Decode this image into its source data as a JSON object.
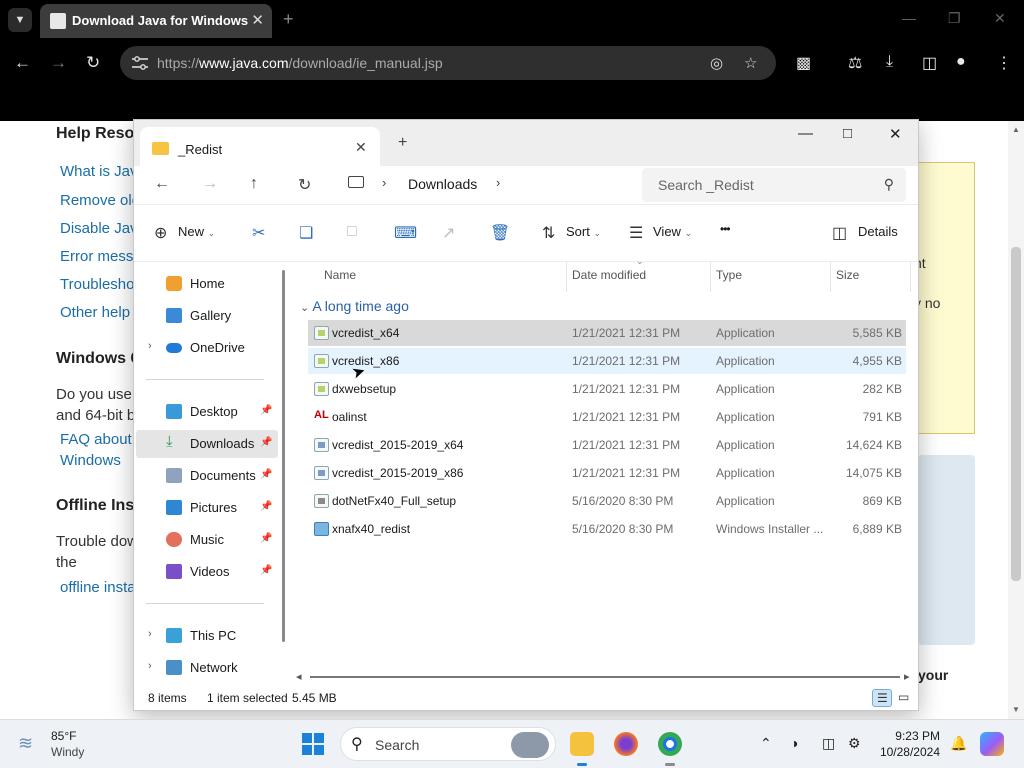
{
  "browser": {
    "tab_title": "Download Java for Windows",
    "url_prefix": "https://",
    "url_domain": "www.java.com",
    "url_path": "/download/ie_manual.jsp"
  },
  "page": {
    "heading1": "Help Reso",
    "links1": [
      "What is Jav",
      "Remove old",
      "Disable Jav",
      "Error mess",
      "Troublesho",
      "Other help"
    ],
    "heading2": "Windows 6",
    "text2a": "Do you use",
    "text2b": "and 64-bit b",
    "link2a": "FAQ about",
    "link2b": "Windows",
    "heading3": "Offline Ins",
    "text3a": "Trouble dow",
    "text3b": "the",
    "link3": "offline insta",
    "yellow_text1": "nt",
    "yellow_text2": "y no",
    "right_text": "your"
  },
  "explorer": {
    "tab_title": "_Redist",
    "breadcrumb": "Downloads",
    "search_placeholder": "Search _Redist",
    "commands": {
      "new": "New",
      "sort": "Sort",
      "view": "View",
      "more": "•••",
      "details": "Details"
    },
    "sidebar": {
      "home": "Home",
      "gallery": "Gallery",
      "onedrive": "OneDrive",
      "desktop": "Desktop",
      "downloads": "Downloads",
      "documents": "Documents",
      "pictures": "Pictures",
      "music": "Music",
      "videos": "Videos",
      "thispc": "This PC",
      "network": "Network"
    },
    "columns": {
      "name": "Name",
      "date": "Date modified",
      "type": "Type",
      "size": "Size"
    },
    "group_header": "A long time ago",
    "files": [
      {
        "name": "vcredist_x64",
        "date": "1/21/2021 12:31 PM",
        "type": "Application",
        "size": "5,585 KB"
      },
      {
        "name": "vcredist_x86",
        "date": "1/21/2021 12:31 PM",
        "type": "Application",
        "size": "4,955 KB"
      },
      {
        "name": "dxwebsetup",
        "date": "1/21/2021 12:31 PM",
        "type": "Application",
        "size": "282 KB"
      },
      {
        "name": "oalinst",
        "date": "1/21/2021 12:31 PM",
        "type": "Application",
        "size": "791 KB"
      },
      {
        "name": "vcredist_2015-2019_x64",
        "date": "1/21/2021 12:31 PM",
        "type": "Application",
        "size": "14,624 KB"
      },
      {
        "name": "vcredist_2015-2019_x86",
        "date": "1/21/2021 12:31 PM",
        "type": "Application",
        "size": "14,075 KB"
      },
      {
        "name": "dotNetFx40_Full_setup",
        "date": "5/16/2020 8:30 PM",
        "type": "Application",
        "size": "869 KB"
      },
      {
        "name": "xnafx40_redist",
        "date": "5/16/2020 8:30 PM",
        "type": "Windows Installer ...",
        "size": "6,889 KB"
      }
    ],
    "status": {
      "count": "8 items",
      "selection": "1 item selected",
      "size": "5.45 MB"
    }
  },
  "taskbar": {
    "temperature": "85°F",
    "condition": "Windy",
    "search": "Search",
    "time": "9:23 PM",
    "date": "10/28/2024"
  }
}
